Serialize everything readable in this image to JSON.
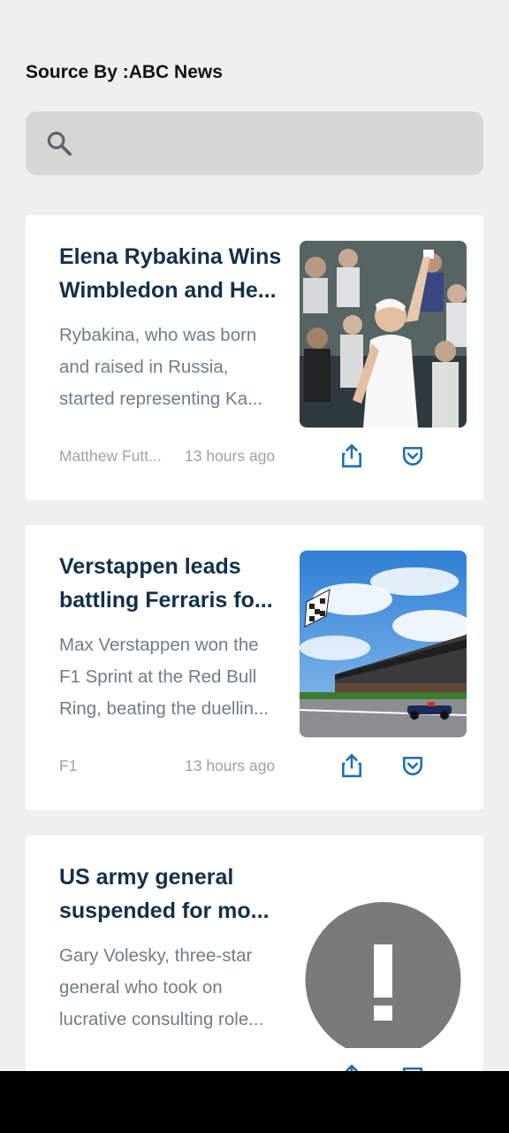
{
  "header": {
    "source": "Source By :ABC News"
  },
  "search": {
    "icon": "search-icon",
    "placeholder": ""
  },
  "articles": [
    {
      "title_lines": [
        "Elena Rybakina Wins",
        "Wimbledon and He..."
      ],
      "desc_lines": [
        "Rybakina, who was born",
        "and raised in Russia,",
        "started representing Ka..."
      ],
      "author": "Matthew Futt...",
      "time": "13 hours ago",
      "image": "tennis player celebrating with raised arm in front of crowd"
    },
    {
      "title_lines": [
        "Verstappen leads",
        "battling Ferraris fo..."
      ],
      "desc_lines": [
        "Max Verstappen won the",
        "F1 Sprint at the Red Bull",
        "Ring, beating the duellin..."
      ],
      "author": "F1",
      "time": "13 hours ago",
      "image": "race track with grandstand, F1 car and chequered flag under blue sky"
    },
    {
      "title_lines": [
        "US army general",
        "suspended for mo..."
      ],
      "desc_lines": [
        "Gary Volesky, three-star",
        "general who took on",
        "lucrative consulting role..."
      ],
      "author": "",
      "time": "",
      "image": "image-error-icon"
    }
  ],
  "colors": {
    "background": "#efefef",
    "title": "#13304a",
    "description": "#6f7d88",
    "meta": "#9aa3aa",
    "action_icon": "#1c6fb5"
  }
}
